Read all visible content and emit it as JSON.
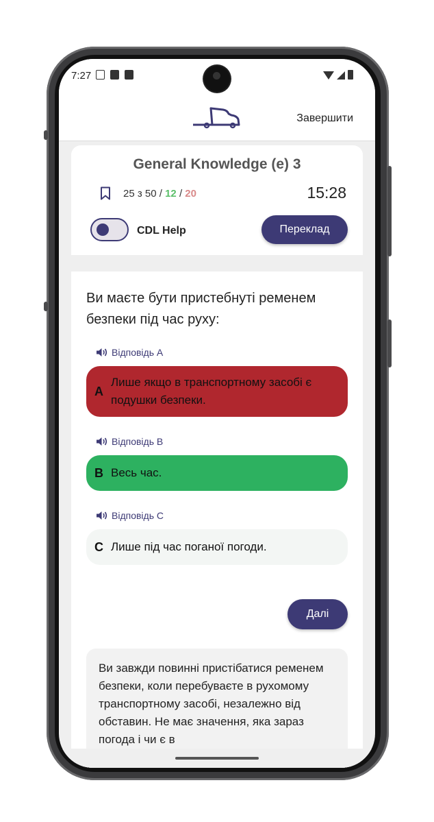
{
  "status_bar": {
    "time": "7:27",
    "left_icons": [
      "screen-icon",
      "a-icon",
      "sd-card-icon"
    ],
    "right_icons": [
      "wifi-icon",
      "cell-signal-icon",
      "battery-icon"
    ]
  },
  "header": {
    "logo": "truck-logo-icon",
    "finish_label": "Завершити"
  },
  "quiz": {
    "title": "General Knowledge (e) 3",
    "progress_prefix": "25 з 50 / ",
    "correct": "12",
    "separator": " / ",
    "wrong": "20",
    "timer": "15:28",
    "cdl_help_label": "CDL Help",
    "cdl_help_on": false,
    "translate_label": "Переклад"
  },
  "question": {
    "text": "Ви маєте бути пристебнуті ременем безпеки під час руху:",
    "answers": [
      {
        "audio_label": "Відповідь A",
        "letter": "A",
        "text": "Лише якщо в транспортному засобі є подушки безпеки.",
        "state": "wrong"
      },
      {
        "audio_label": "Відповідь B",
        "letter": "B",
        "text": "Весь час.",
        "state": "correct"
      },
      {
        "audio_label": "Відповідь C",
        "letter": "C",
        "text": "Лише під час поганої погоди.",
        "state": "neutral"
      }
    ],
    "next_label": "Далі",
    "explanation": "Ви завжди повинні пристібатися ременем безпеки, коли перебуваєте в рухомому транспортному засобі, незалежно від обставин. Не має значення, яка зараз погода і чи є в"
  },
  "colors": {
    "accent": "#3d3a75",
    "wrong": "#b0272e",
    "correct": "#2db160",
    "correct_count": "#5bbf6a",
    "wrong_count": "#d98a8a"
  }
}
